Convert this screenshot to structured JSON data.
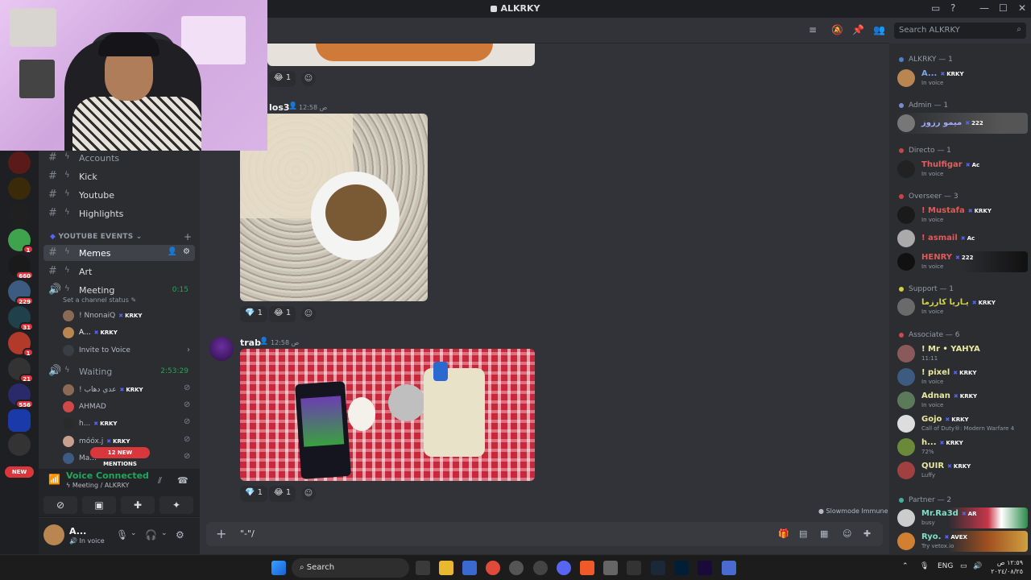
{
  "window": {
    "title": "ALKRKY",
    "minimize": "—",
    "maximize": "☐",
    "close": "✕"
  },
  "servers": [
    {
      "badge": ""
    },
    {
      "badge": ""
    },
    {
      "badge": ""
    },
    {
      "badge": "1"
    },
    {
      "badge": "660"
    },
    {
      "badge": "229"
    },
    {
      "badge": "31"
    },
    {
      "badge": "1"
    },
    {
      "badge": "21"
    },
    {
      "badge": "556"
    },
    {
      "badge": ""
    },
    {
      "badge": ""
    }
  ],
  "new_label": "NEW",
  "sidebar": {
    "channels_top": [
      {
        "name": "Accounts"
      },
      {
        "name": "Kick"
      },
      {
        "name": "Youtube"
      },
      {
        "name": "Highlights"
      }
    ],
    "category": "YOUTUBE EVENTS",
    "channels": [
      {
        "name": "Memes"
      },
      {
        "name": "Art"
      }
    ],
    "voice_channel": {
      "name": "Meeting",
      "timer": "0:15",
      "status": "Set a channel status"
    },
    "meeting_users": [
      {
        "name": "! NnonaiQ",
        "tag": "KRKY"
      },
      {
        "name": "A...",
        "tag": "KRKY"
      }
    ],
    "invite": "Invite to Voice",
    "waiting_channel": {
      "name": "Waiting",
      "timer": "2:53:29"
    },
    "waiting_users": [
      {
        "name": "! عدي دهاب",
        "tag": "KRKY"
      },
      {
        "name": "AHMAD",
        "tag": ""
      },
      {
        "name": "h...",
        "tag": "KRKY"
      },
      {
        "name": "móóx.j",
        "tag": "KRKY"
      },
      {
        "name": "Ma...",
        "tag": ""
      }
    ],
    "mentions": "12 NEW MENTIONS"
  },
  "voice_panel": {
    "title": "Voice Connected",
    "subtitle": "Meeting / ALKRKY"
  },
  "user_panel": {
    "name": "A...",
    "status": "In voice"
  },
  "chat": {
    "search_placeholder": "Search ALKRKY",
    "messages": [
      {
        "reactions": [
          {
            "emoji": "😂",
            "count": "1"
          }
        ]
      },
      {
        "author": "los3",
        "time": "12:58 ص",
        "reactions": [
          {
            "emoji": "💎",
            "count": "1"
          },
          {
            "emoji": "😂",
            "count": "1"
          }
        ]
      },
      {
        "author": "trab",
        "time": "12:58 ص",
        "reactions": [
          {
            "emoji": "💎",
            "count": "1"
          },
          {
            "emoji": "😂",
            "count": "1"
          }
        ]
      }
    ],
    "slowmode": "Slowmode Immune",
    "composer_text": "\"-\"/"
  },
  "members": {
    "roles": [
      {
        "name": "ALKRKY — 1",
        "color": "#4f7fc4"
      },
      {
        "name": "Admin — 1",
        "color": "#7a8bd0"
      },
      {
        "name": "Directo — 1",
        "color": "#c04848"
      },
      {
        "name": "Overseer — 3",
        "color": "#d04040"
      },
      {
        "name": "Support — 1",
        "color": "#d0d040"
      },
      {
        "name": "Associate — 6",
        "color": "#d04848"
      },
      {
        "name": "Partner — 2",
        "color": "#3cb4a0"
      }
    ],
    "list": [
      {
        "name": "A...",
        "tag": "KRKY",
        "status": "In voice",
        "color": "#7aa7e8"
      },
      {
        "name": "ميمو رزوز",
        "tag": "222",
        "status": "",
        "color": "#a0a8ff"
      },
      {
        "name": "Thulfigar",
        "tag": "Ac",
        "status": "In voice",
        "color": "#e06060"
      },
      {
        "name": "! Mustafa",
        "tag": "KRKY",
        "status": "In voice",
        "color": "#e05a5a"
      },
      {
        "name": "! asmail",
        "tag": "Ac",
        "status": "",
        "color": "#e05a5a"
      },
      {
        "name": "HENRY",
        "tag": "222",
        "status": "In voice",
        "color": "#e05a5a"
      },
      {
        "name": "يـاريا كارزما",
        "tag": "KRKY",
        "status": "In voice",
        "color": "#d6d24a"
      },
      {
        "name": "! Mr • YAHYA",
        "tag": "",
        "status": "11:11",
        "color": "#e8e8a0"
      },
      {
        "name": "! pixel",
        "tag": "KRKY",
        "status": "In voice",
        "color": "#e8e8a0"
      },
      {
        "name": "Adnan",
        "tag": "KRKY",
        "status": "In voice",
        "color": "#e8e8a0"
      },
      {
        "name": "Gojo",
        "tag": "KRKY",
        "status": "Call of Duty®: Modern Warfare 4",
        "color": "#e8e8a0"
      },
      {
        "name": "h...",
        "tag": "KRKY",
        "status": "72%",
        "color": "#e8e8a0"
      },
      {
        "name": "QUIR",
        "tag": "KRKY",
        "status": "Luffy",
        "color": "#e8e8a0"
      },
      {
        "name": "Mr.Ra3d",
        "tag": "AR",
        "status": "busy",
        "color": "#7fe0c8"
      },
      {
        "name": "Ryo.",
        "tag": "AVEX",
        "status": "Try vetox.io",
        "color": "#7fe0c8"
      }
    ]
  },
  "taskbar": {
    "search": "Search",
    "lang": "ENG",
    "time": "١٢:٥٩ ص",
    "date": "٢٠٢٤/٠٨/٢٥"
  }
}
